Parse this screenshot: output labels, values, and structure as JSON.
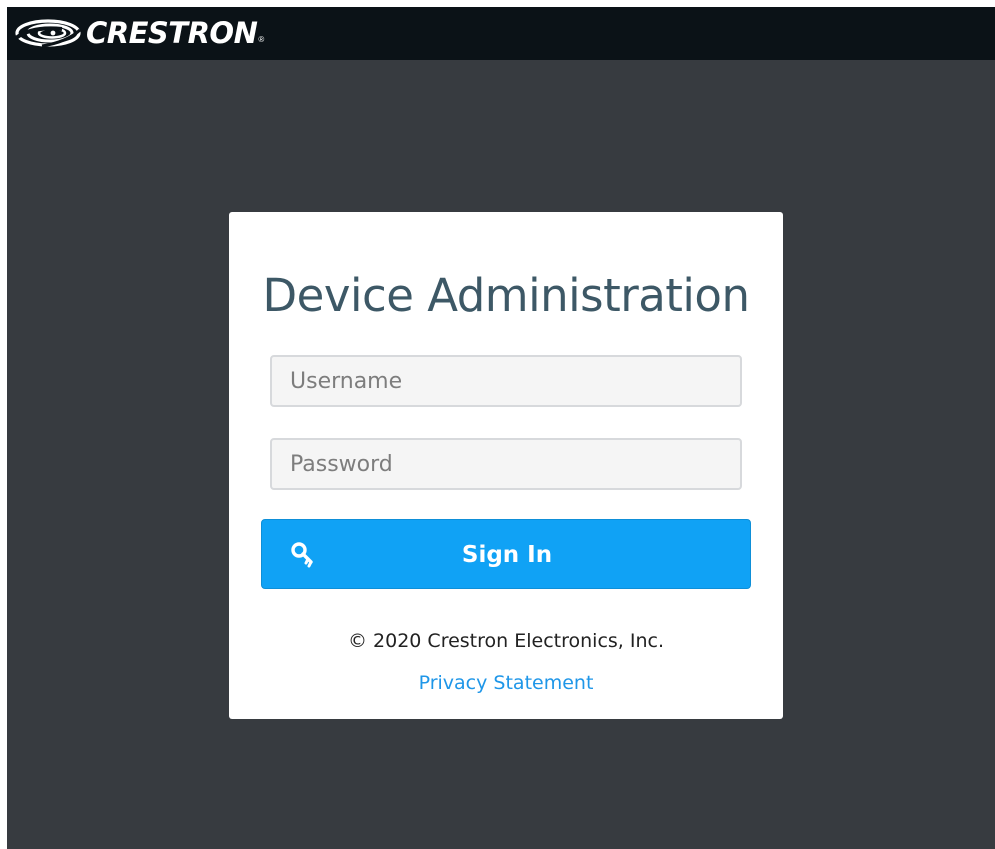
{
  "header": {
    "brand": "CRESTRON",
    "registered_mark": "®",
    "logo_icon": "crestron-swirl-logo"
  },
  "login": {
    "title": "Device Administration",
    "username_placeholder": "Username",
    "password_placeholder": "Password",
    "sign_in_label": "Sign In",
    "sign_in_icon": "key-icon",
    "copyright": "© 2020 Crestron Electronics, Inc.",
    "privacy_link": "Privacy Statement"
  },
  "colors": {
    "topbar": "#0b1217",
    "background": "#373b40",
    "card": "#ffffff",
    "title": "#3d5866",
    "accent": "#10a2f5",
    "link": "#1e96e8"
  }
}
